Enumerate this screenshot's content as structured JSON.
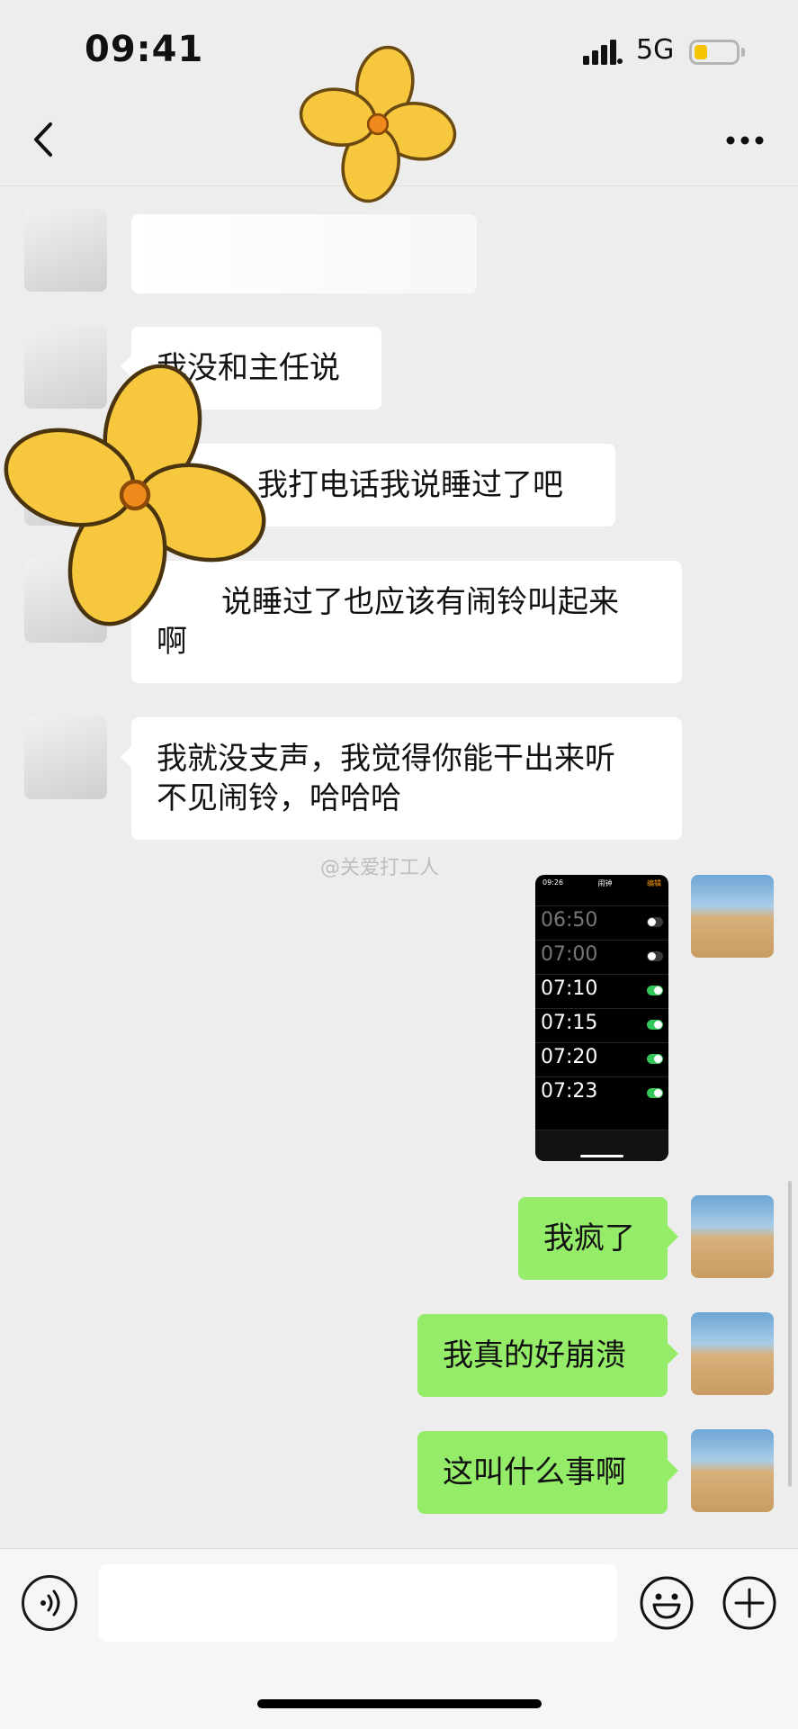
{
  "status_bar": {
    "time": "09:41",
    "network": "5G"
  },
  "watermark": "@关爱打工人",
  "messages": [
    {
      "text": "我没和主任说"
    },
    {
      "text": "我打电话我说睡过了吧"
    },
    {
      "line1": "说睡过了也应该有闹铃叫起来",
      "line2": "啊"
    },
    {
      "line1": "我就没支声，我觉得你能干出来听",
      "line2": "不见闹铃，哈哈哈"
    },
    {
      "text": "我疯了"
    },
    {
      "text": "我真的好崩溃"
    },
    {
      "text": "这叫什么事啊"
    }
  ],
  "alarm_screenshot": {
    "time": "09:26",
    "title": "闹钟",
    "edit": "编辑",
    "alarms": [
      {
        "time": "06:50",
        "on": false
      },
      {
        "time": "07:00",
        "on": false
      },
      {
        "time": "07:10",
        "on": true
      },
      {
        "time": "07:15",
        "on": true
      },
      {
        "time": "07:20",
        "on": true
      },
      {
        "time": "07:23",
        "on": true
      }
    ]
  },
  "icons": {
    "back": "back-chevron-icon",
    "more": "more-dots-icon",
    "voice": "voice-icon",
    "emoji": "emoji-icon",
    "plus": "plus-icon",
    "flower": "flower-sticker"
  },
  "colors": {
    "background": "#ededed",
    "my_bubble": "#95ec69",
    "friend_bubble": "#ffffff",
    "battery": "#f5c400"
  }
}
